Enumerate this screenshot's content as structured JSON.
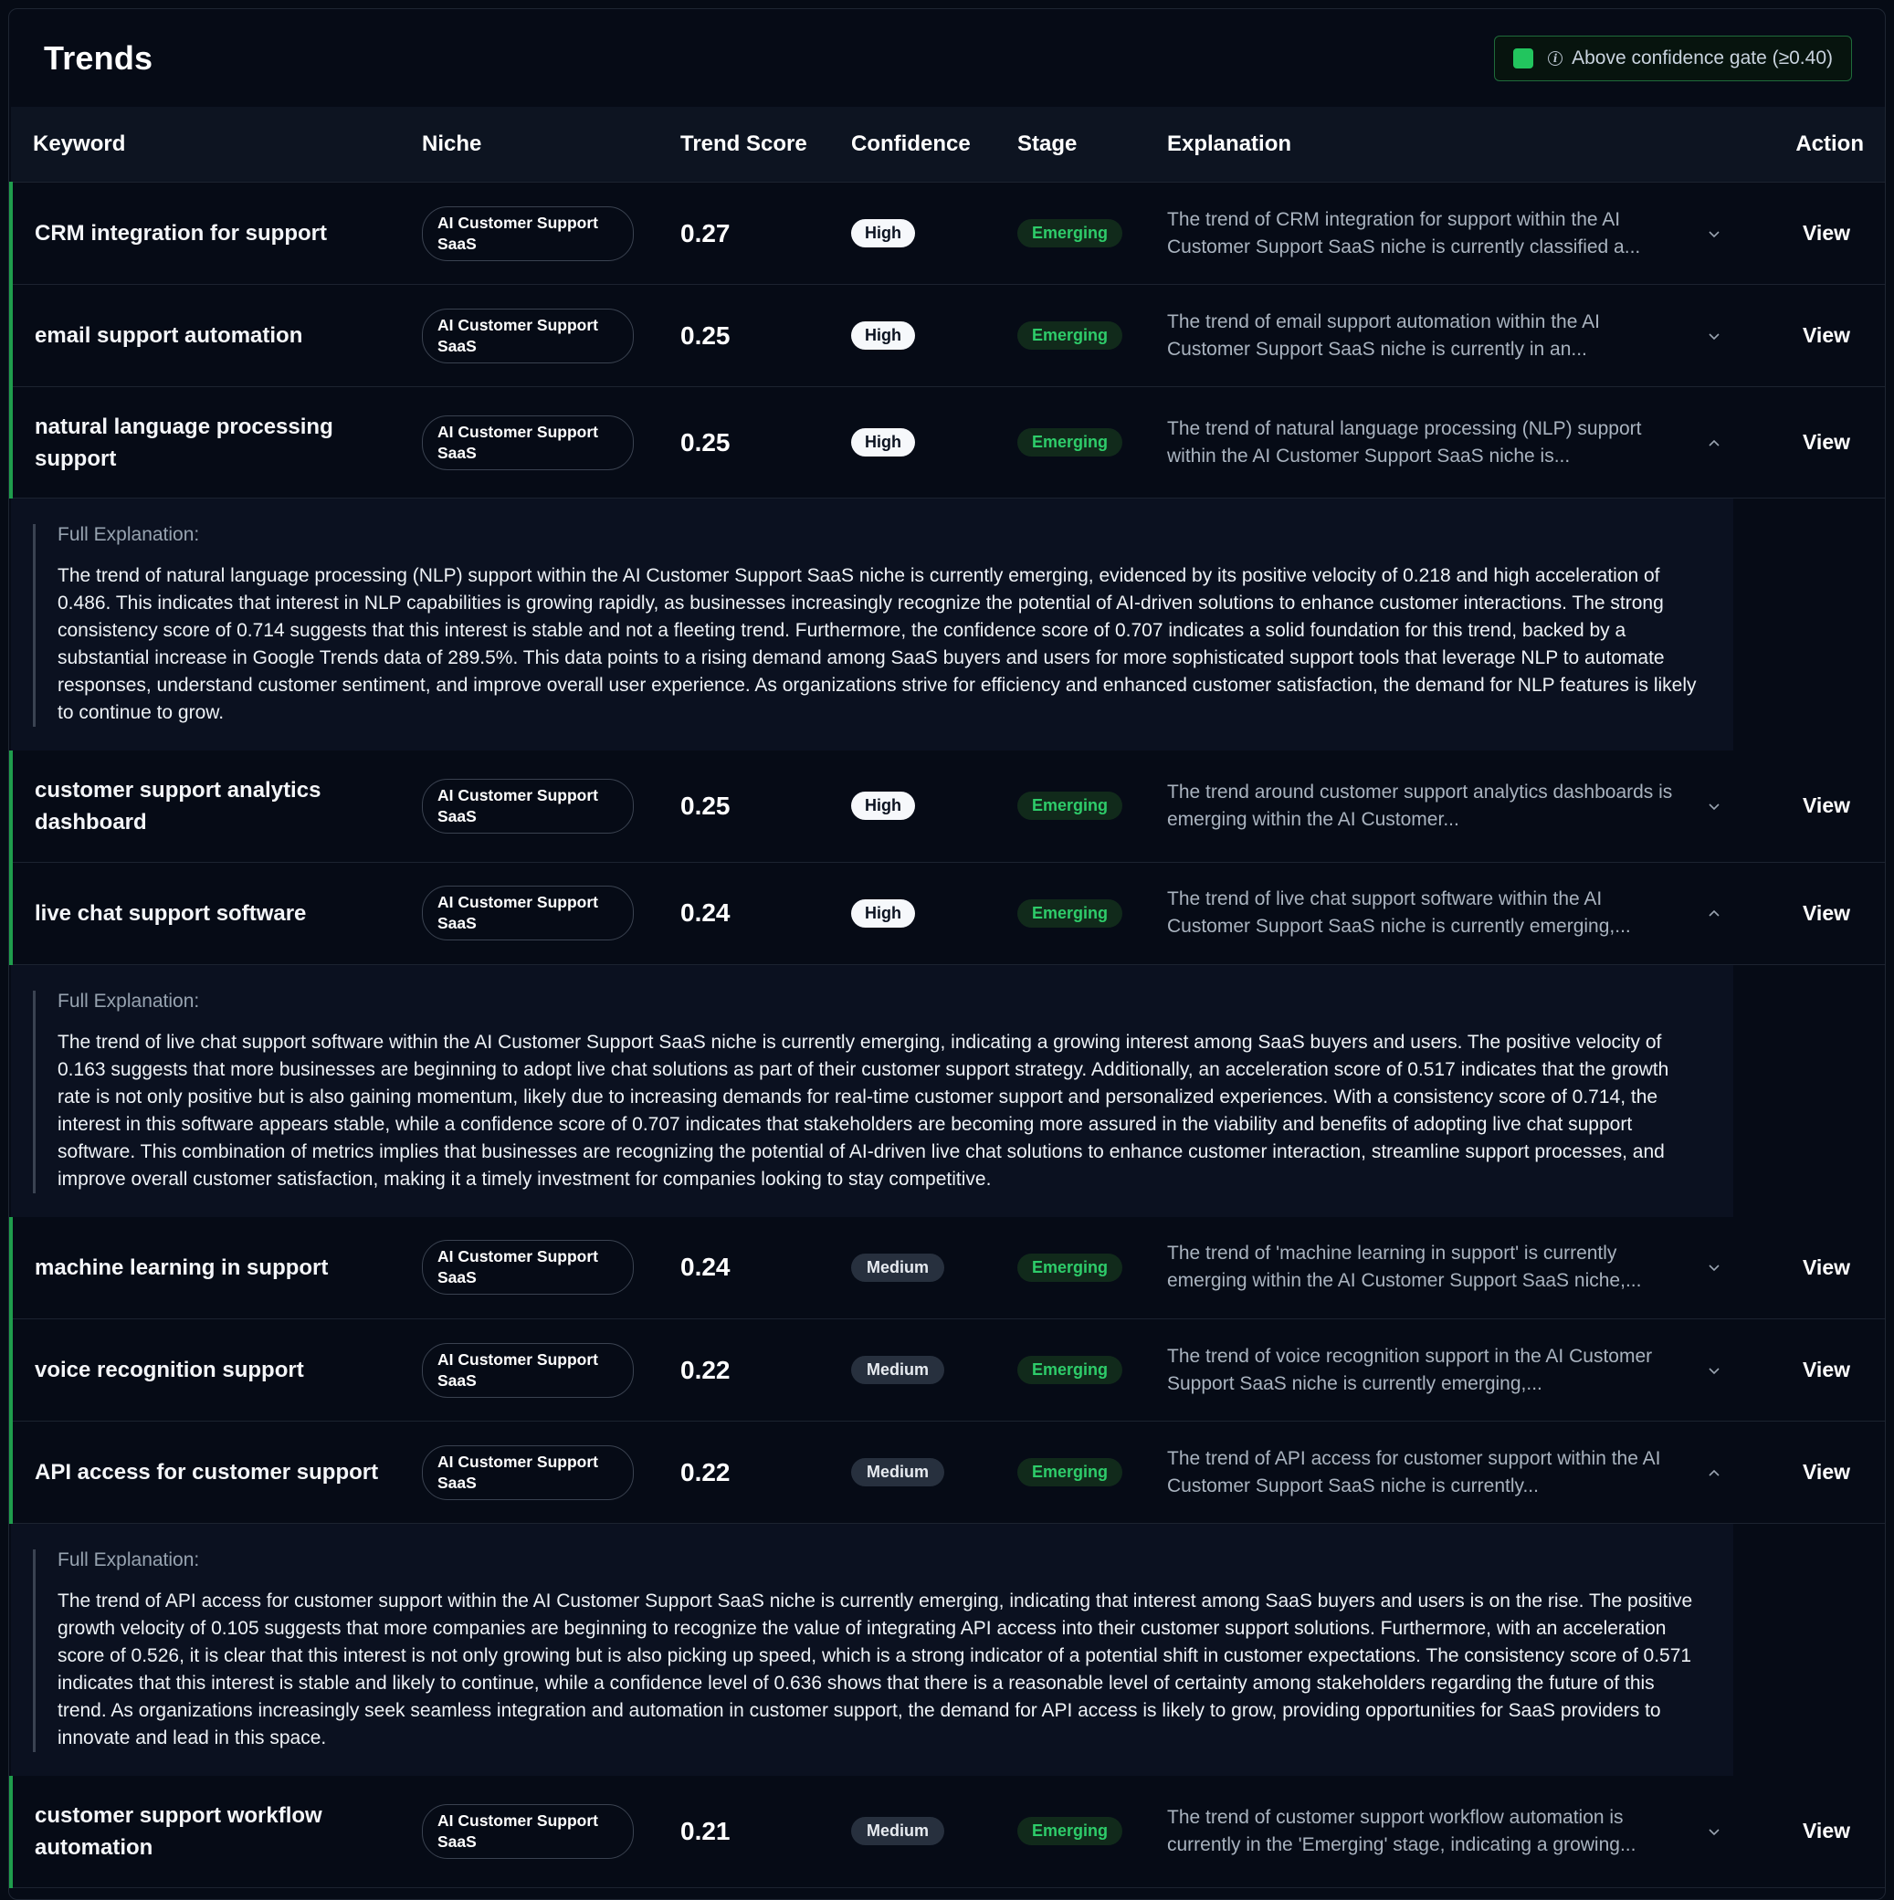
{
  "header": {
    "title": "Trends",
    "gate_label": "Above confidence gate (≥0.40)",
    "gate_color": "#22c55e"
  },
  "columns": {
    "keyword": "Keyword",
    "niche": "Niche",
    "trend_score": "Trend Score",
    "confidence": "Confidence",
    "stage": "Stage",
    "explanation": "Explanation",
    "action": "Action"
  },
  "detail_label": "Full Explanation:",
  "rows": [
    {
      "keyword": "CRM integration for support",
      "niche": "AI Customer Support SaaS",
      "score": "0.27",
      "confidence": "High",
      "stage": "Emerging",
      "explanation": "The trend of CRM integration for support within the AI Customer Support SaaS niche is currently classified a...",
      "expanded": false,
      "action": "View"
    },
    {
      "keyword": "email support automation",
      "niche": "AI Customer Support SaaS",
      "score": "0.25",
      "confidence": "High",
      "stage": "Emerging",
      "explanation": "The trend of email support automation within the AI Customer Support SaaS niche is currently in an...",
      "expanded": false,
      "action": "View"
    },
    {
      "keyword": "natural language processing support",
      "niche": "AI Customer Support SaaS",
      "score": "0.25",
      "confidence": "High",
      "stage": "Emerging",
      "explanation": "The trend of natural language processing (NLP) support within the AI Customer Support SaaS niche is...",
      "expanded": true,
      "full_explanation": "The trend of natural language processing (NLP) support within the AI Customer Support SaaS niche is currently emerging, evidenced by its positive velocity of 0.218 and high acceleration of 0.486. This indicates that interest in NLP capabilities is growing rapidly, as businesses increasingly recognize the potential of AI-driven solutions to enhance customer interactions. The strong consistency score of 0.714 suggests that this interest is stable and not a fleeting trend. Furthermore, the confidence score of 0.707 indicates a solid foundation for this trend, backed by a substantial increase in Google Trends data of 289.5%. This data points to a rising demand among SaaS buyers and users for more sophisticated support tools that leverage NLP to automate responses, understand customer sentiment, and improve overall user experience. As organizations strive for efficiency and enhanced customer satisfaction, the demand for NLP features is likely to continue to grow.",
      "action": "View"
    },
    {
      "keyword": "customer support analytics dashboard",
      "niche": "AI Customer Support SaaS",
      "score": "0.25",
      "confidence": "High",
      "stage": "Emerging",
      "explanation": "The trend around customer support analytics dashboards is emerging within the AI Customer...",
      "expanded": false,
      "action": "View"
    },
    {
      "keyword": "live chat support software",
      "niche": "AI Customer Support SaaS",
      "score": "0.24",
      "confidence": "High",
      "stage": "Emerging",
      "explanation": "The trend of live chat support software within the AI Customer Support SaaS niche is currently emerging,...",
      "expanded": true,
      "full_explanation": "The trend of live chat support software within the AI Customer Support SaaS niche is currently emerging, indicating a growing interest among SaaS buyers and users. The positive velocity of 0.163 suggests that more businesses are beginning to adopt live chat solutions as part of their customer support strategy. Additionally, an acceleration score of 0.517 indicates that the growth rate is not only positive but is also gaining momentum, likely due to increasing demands for real-time customer support and personalized experiences. With a consistency score of 0.714, the interest in this software appears stable, while a confidence score of 0.707 indicates that stakeholders are becoming more assured in the viability and benefits of adopting live chat support software. This combination of metrics implies that businesses are recognizing the potential of AI-driven live chat solutions to enhance customer interaction, streamline support processes, and improve overall customer satisfaction, making it a timely investment for companies looking to stay competitive.",
      "action": "View"
    },
    {
      "keyword": "machine learning in support",
      "niche": "AI Customer Support SaaS",
      "score": "0.24",
      "confidence": "Medium",
      "stage": "Emerging",
      "explanation": "The trend of 'machine learning in support' is currently emerging within the AI Customer Support SaaS niche,...",
      "expanded": false,
      "action": "View"
    },
    {
      "keyword": "voice recognition support",
      "niche": "AI Customer Support SaaS",
      "score": "0.22",
      "confidence": "Medium",
      "stage": "Emerging",
      "explanation": "The trend of voice recognition support in the AI Customer Support SaaS niche is currently emerging,...",
      "expanded": false,
      "action": "View"
    },
    {
      "keyword": "API access for customer support",
      "niche": "AI Customer Support SaaS",
      "score": "0.22",
      "confidence": "Medium",
      "stage": "Emerging",
      "explanation": "The trend of API access for customer support within the AI Customer Support SaaS niche is currently...",
      "expanded": true,
      "full_explanation": "The trend of API access for customer support within the AI Customer Support SaaS niche is currently emerging, indicating that interest among SaaS buyers and users is on the rise. The positive growth velocity of 0.105 suggests that more companies are beginning to recognize the value of integrating API access into their customer support solutions. Furthermore, with an acceleration score of 0.526, it is clear that this interest is not only growing but is also picking up speed, which is a strong indicator of a potential shift in customer expectations. The consistency score of 0.571 indicates that this interest is stable and likely to continue, while a confidence level of 0.636 shows that there is a reasonable level of certainty among stakeholders regarding the future of this trend. As organizations increasingly seek seamless integration and automation in customer support, the demand for API access is likely to grow, providing opportunities for SaaS providers to innovate and lead in this space.",
      "action": "View"
    },
    {
      "keyword": "customer support workflow automation",
      "niche": "AI Customer Support SaaS",
      "score": "0.21",
      "confidence": "Medium",
      "stage": "Emerging",
      "explanation": "The trend of customer support workflow automation is currently in the 'Emerging' stage, indicating a growing...",
      "expanded": false,
      "action": "View"
    }
  ]
}
